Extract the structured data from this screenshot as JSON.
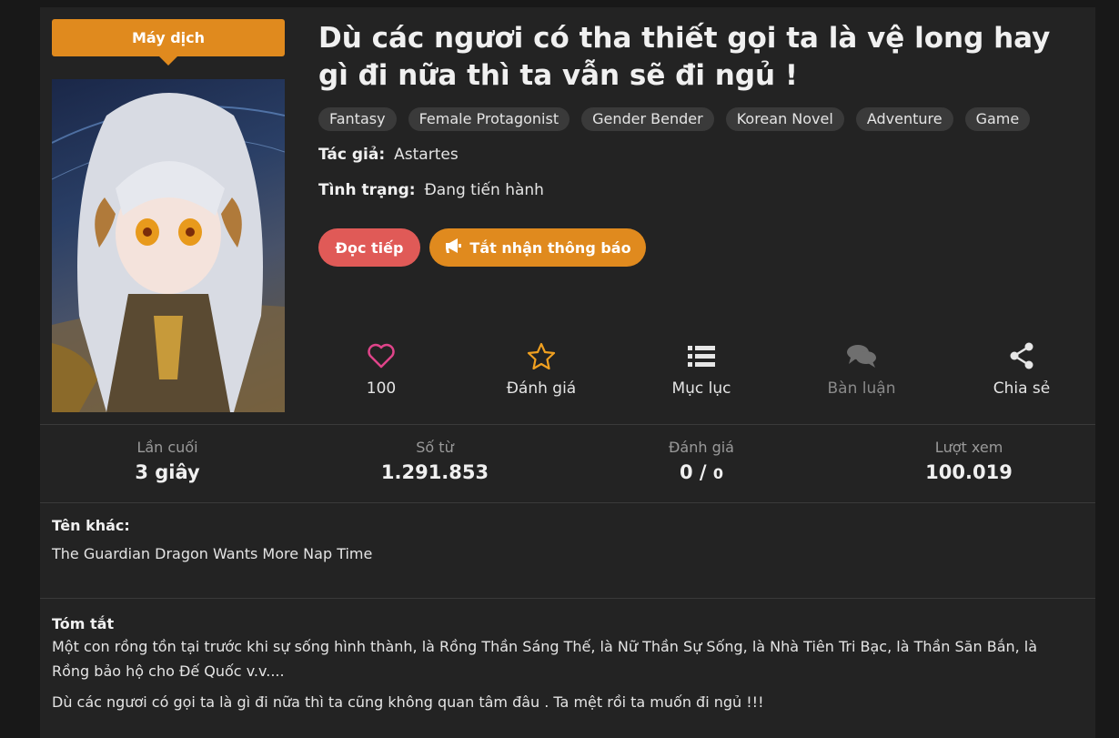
{
  "badge": "Máy dịch",
  "title": "Dù các ngươi có tha thiết gọi ta là vệ long hay gì đi nữa thì ta vẫn sẽ đi ngủ !",
  "tags": [
    "Fantasy",
    "Female Protagonist",
    "Gender Bender",
    "Korean Novel",
    "Adventure",
    "Game"
  ],
  "author": {
    "label": "Tác giả:",
    "value": "Astartes"
  },
  "status": {
    "label": "Tình trạng:",
    "value": "Đang tiến hành"
  },
  "buttons": {
    "read": "Đọc tiếp",
    "notify": "Tắt nhận thông báo"
  },
  "actions": [
    {
      "icon": "heart-icon",
      "label": "100"
    },
    {
      "icon": "star-icon",
      "label": "Đánh giá"
    },
    {
      "icon": "list-icon",
      "label": "Mục lục"
    },
    {
      "icon": "comments-icon",
      "label": "Bàn luận"
    },
    {
      "icon": "share-icon",
      "label": "Chia sẻ"
    }
  ],
  "stats": [
    {
      "label": "Lần cuối",
      "value": "3 giây"
    },
    {
      "label": "Số từ",
      "value": "1.291.853"
    },
    {
      "label": "Đánh giá",
      "value": "0 /",
      "sub": "0"
    },
    {
      "label": "Lượt xem",
      "value": "100.019"
    }
  ],
  "other_names": {
    "heading": "Tên khác:",
    "value": "The Guardian Dragon Wants More Nap Time"
  },
  "summary": {
    "heading": "Tóm tắt",
    "paragraphs": [
      "Một con rồng tồn tại trước khi sự sống hình thành, là Rồng Thần Sáng Thế, là Nữ Thần Sự Sống, là Nhà Tiên Tri Bạc, là Thần Săn Bắn, là Rồng bảo hộ cho Đế Quốc v.v....",
      "Dù các ngươi có gọi ta là gì đi nữa thì ta cũng không quan tâm đâu . Ta mệt rồi ta muốn đi ngủ !!!"
    ]
  },
  "colors": {
    "accent_orange": "#e08a1e",
    "accent_red": "#e05a57",
    "heart_pink": "#e0448a",
    "star_orange": "#f0a020"
  }
}
